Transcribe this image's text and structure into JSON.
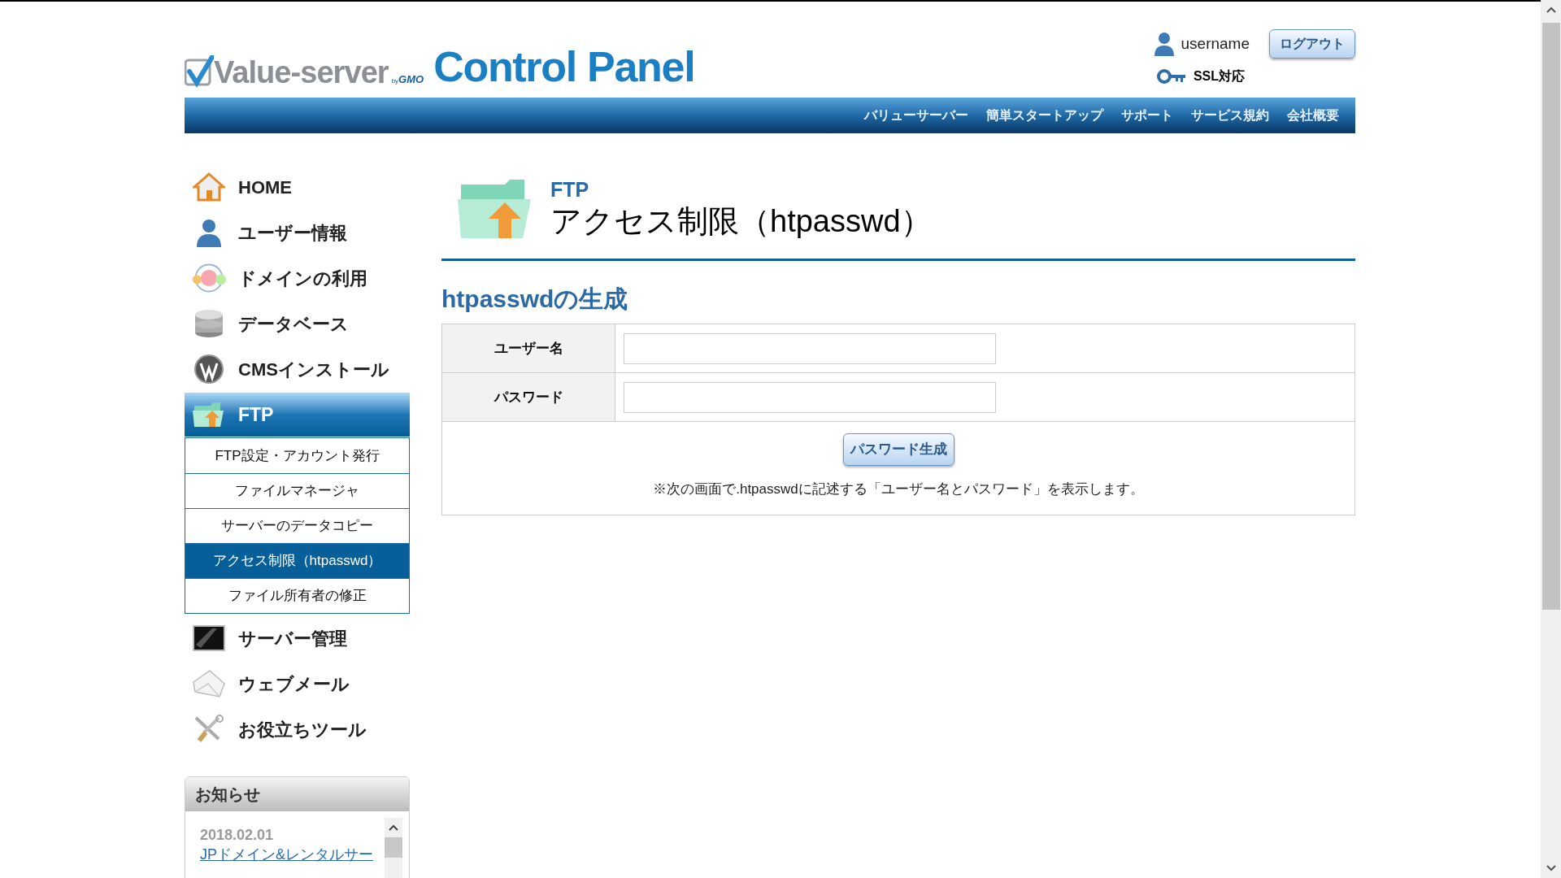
{
  "header": {
    "logo": {
      "brand": "Value-server",
      "by": "by",
      "gmo": "GMO",
      "product": "Control Panel"
    },
    "user": "username",
    "logout": "ログアウト",
    "ssl": "SSL対応"
  },
  "nav": [
    "バリューサーバー",
    "簡単スタートアップ",
    "サポート",
    "サービス規約",
    "会社概要"
  ],
  "sidebar": {
    "items": [
      {
        "label": "HOME",
        "selected": false
      },
      {
        "label": "ユーザー情報",
        "selected": false
      },
      {
        "label": "ドメインの利用",
        "selected": false
      },
      {
        "label": "データベース",
        "selected": false
      },
      {
        "label": "CMSインストール",
        "selected": false
      },
      {
        "label": "FTP",
        "selected": true,
        "children": [
          {
            "label": "FTP設定・アカウント発行",
            "selected": false
          },
          {
            "label": "ファイルマネージャ",
            "selected": false
          },
          {
            "label": "サーバーのデータコピー",
            "selected": false
          },
          {
            "label": "アクセス制限（htpasswd）",
            "selected": true
          },
          {
            "label": "ファイル所有者の修正",
            "selected": false
          }
        ]
      },
      {
        "label": "サーバー管理",
        "selected": false
      },
      {
        "label": "ウェブメール",
        "selected": false
      },
      {
        "label": "お役立ちツール",
        "selected": false
      }
    ]
  },
  "news": {
    "title": "お知らせ",
    "items": [
      {
        "date": "2018.02.01",
        "link": "JPドメイン&レンタルサー"
      }
    ]
  },
  "main": {
    "section": "FTP",
    "title": "アクセス制限（htpasswd）",
    "subtitle": "htpasswdの生成",
    "fields": [
      {
        "label": "ユーザー名"
      },
      {
        "label": "パスワード"
      }
    ],
    "button": "パスワード生成",
    "note": "※次の画面で.htpasswdに記述する「ユーザー名とパスワード」を表示します。"
  }
}
